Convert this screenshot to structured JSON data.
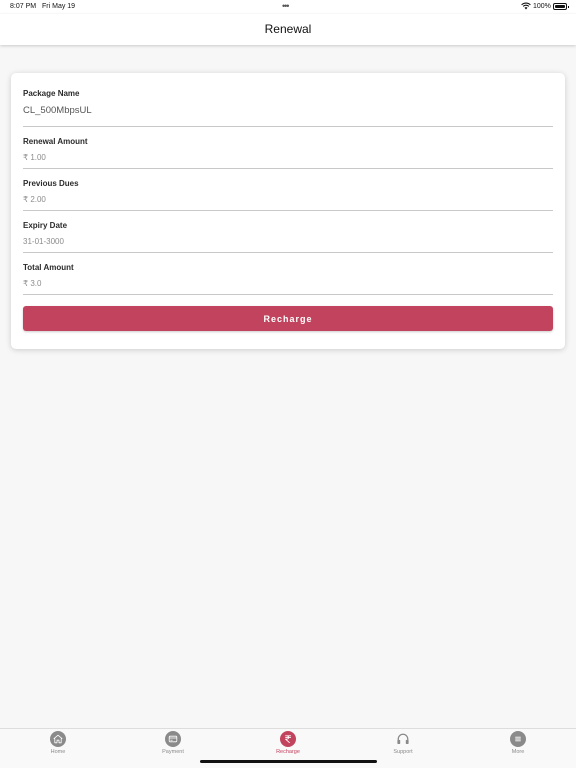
{
  "status_bar": {
    "time": "8:07 PM",
    "date": "Fri May 19",
    "battery": "100%"
  },
  "header": {
    "title": "Renewal"
  },
  "form": {
    "package_name": {
      "label": "Package Name",
      "value": "CL_500MbpsUL"
    },
    "renewal_amount": {
      "label": "Renewal Amount",
      "value": "₹ 1.00"
    },
    "previous_dues": {
      "label": "Previous Dues",
      "value": "₹ 2.00"
    },
    "expiry_date": {
      "label": "Expiry Date",
      "value": "31-01-3000"
    },
    "total_amount": {
      "label": "Total Amount",
      "value": "₹ 3.0"
    },
    "recharge_label": "Recharge"
  },
  "tabs": [
    {
      "label": "Home",
      "icon": "home-icon"
    },
    {
      "label": "Payment",
      "icon": "payment-icon"
    },
    {
      "label": "Recharge",
      "icon": "rupee-icon",
      "active": true
    },
    {
      "label": "Support",
      "icon": "headphones-icon"
    },
    {
      "label": "More",
      "icon": "menu-icon"
    }
  ],
  "colors": {
    "accent": "#c2435e",
    "tab_inactive": "#8a8a8a",
    "background": "#f7f7f7"
  }
}
